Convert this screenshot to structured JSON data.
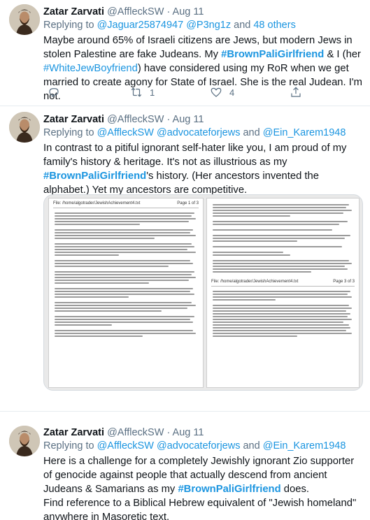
{
  "tweets": [
    {
      "author": "Zatar Zarvati",
      "handle": "@AffleckSW",
      "sep": "·",
      "date": "Aug 11",
      "reply_prefix": "Replying to",
      "reply_users": [
        "@Jaguar25874947",
        "@P3ng1z"
      ],
      "reply_and": "and",
      "reply_others": "48 others",
      "text_parts": [
        {
          "t": "Maybe around 65% of Israeli citizens are Jews, but modern Jews in stolen Palestine are fake Judeans. My ",
          "tag": false
        },
        {
          "t": "#BrownPaliGirlfriend",
          "tag": true
        },
        {
          "t": " & I (her ",
          "tag": false
        },
        {
          "t": "#WhiteJewBoyfriend",
          "tag": "link"
        },
        {
          "t": ") have considered using my RoR when we get married to create agony for State of Israel. She is the real Judean. I'm not.",
          "tag": false
        }
      ],
      "reply_count": "",
      "retweet_count": "1",
      "like_count": "4"
    },
    {
      "author": "Zatar Zarvati",
      "handle": "@AffleckSW",
      "sep": "·",
      "date": "Aug 11",
      "reply_prefix": "Replying to",
      "reply_users": [
        "@AffleckSW",
        "@advocateforjews",
        "@Ein_Karem1948"
      ],
      "reply_and": "and",
      "text_parts": [
        {
          "t": "In contrast to a pitiful ignorant self-hater like you, I am proud of my family's history & heritage. It's not as illustrious as my ",
          "tag": false
        },
        {
          "t": "#BrownPaliGirlfriend",
          "tag": true
        },
        {
          "t": "'s history. (Her ancestors invented the alphabet.) Yet my ancestors are competitive.",
          "tag": false
        }
      ],
      "attachment": {
        "doc1_title": "File: /home/algotrader/JewishAchievement4.txt",
        "doc1_page": "Page 1 of 3",
        "doc2_title": "File: /home/algotrader/JewishAchievement4.txt",
        "doc2_page": "Page 3 of 3"
      }
    },
    {
      "author": "Zatar Zarvati",
      "handle": "@AffleckSW",
      "sep": "·",
      "date": "Aug 11",
      "reply_prefix": "Replying to",
      "reply_users": [
        "@AffleckSW",
        "@advocateforjews",
        "@Ein_Karem1948"
      ],
      "reply_and": "and",
      "text_parts": [
        {
          "t": "Here is a challenge for a completely Jewishly ignorant Zio supporter of genocide against people that actually descend from ancient Judeans & Samarians as my ",
          "tag": false
        },
        {
          "t": "#BrownPaliGirlfriend",
          "tag": true
        },
        {
          "t": " does.",
          "tag": false
        }
      ],
      "text2": "Find reference to a Biblical Hebrew equivalent of \"Jewish homeland\" anywhere in Masoretic text."
    }
  ],
  "colors": {
    "link": "#1b95e0",
    "muted": "#5b7083",
    "text": "#0f1419"
  },
  "icons": [
    "reply-icon",
    "retweet-icon",
    "like-icon",
    "share-icon"
  ]
}
